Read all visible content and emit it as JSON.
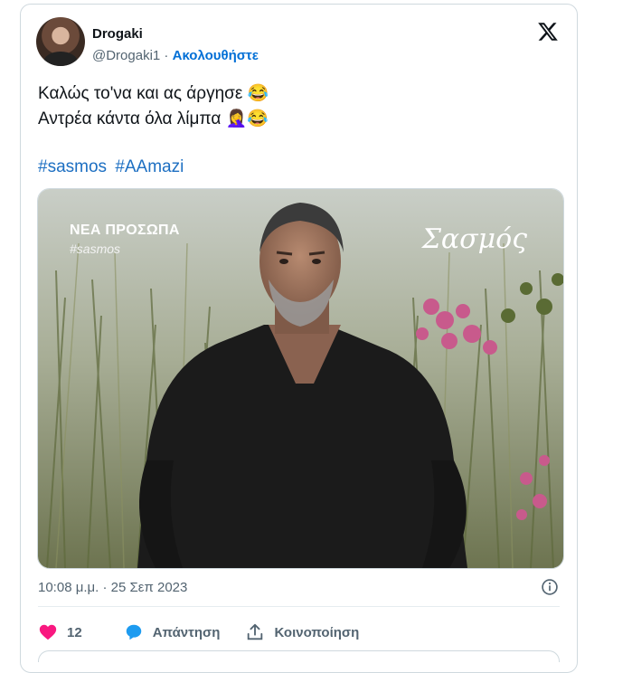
{
  "author": {
    "name": "Drogaki",
    "handle": "@Drogaki1",
    "separator": " · ",
    "follow_label": "Ακολουθήστε"
  },
  "tweet": {
    "lines": [
      "Καλώς το'να και ας άργησε 😂",
      "Αντρέα κάντα όλα λίμπα 🤦‍♀️😂"
    ],
    "hashtags": [
      "#sasmos",
      "#AAmazi"
    ]
  },
  "media": {
    "overlay_title": "ΝΕΑ ΠΡΟΣΩΠΑ",
    "overlay_hashtag": "#sasmos",
    "overlay_logo": "Σασμός"
  },
  "timestamp": "10:08 μ.μ. · 25 Σεπ 2023",
  "actions": {
    "like_count": "12",
    "reply_label": "Απάντηση",
    "share_label": "Κοινοποίηση"
  },
  "colors": {
    "accent": "#1d9bf0",
    "like": "#f91880",
    "follow": "#006fd6",
    "muted": "#536471"
  },
  "icons": [
    "x-logo-icon",
    "heart-icon",
    "reply-bubble-icon",
    "share-icon",
    "info-icon"
  ]
}
